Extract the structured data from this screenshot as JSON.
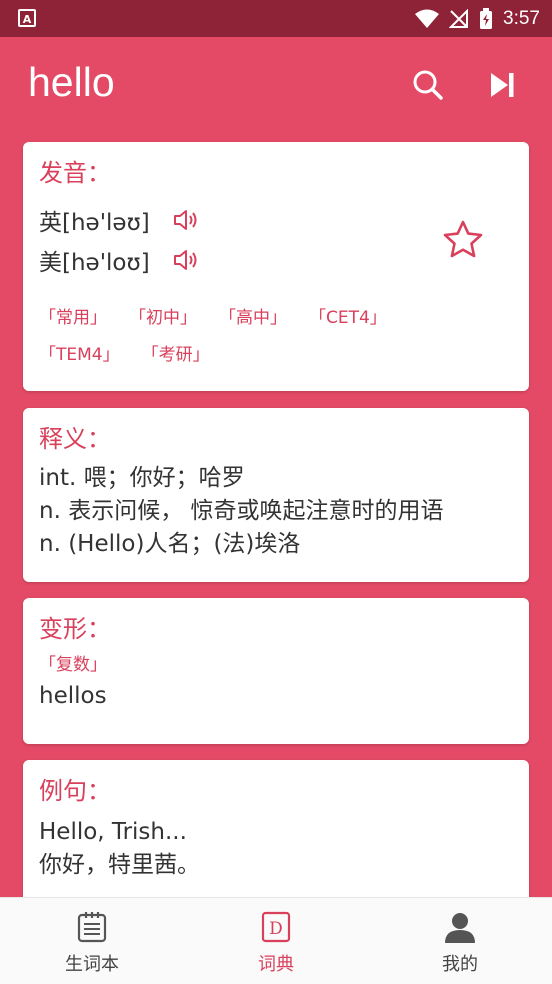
{
  "status_bar": {
    "left_icon_letter": "A",
    "time": "3:57"
  },
  "app_bar": {
    "title": "hello",
    "icons": [
      "search-icon",
      "skip-next-icon"
    ]
  },
  "pronunciation": {
    "heading": "发音：",
    "uk": "英[hə'ləʊ]",
    "us": "美[hə'loʊ]",
    "tags": [
      "「常用」",
      "「初中」",
      "「高中」",
      "「CET4」",
      "「TEM4」",
      "「考研」"
    ]
  },
  "definition": {
    "heading": "释义：",
    "lines": [
      "int. 喂；你好；哈罗",
      "n. 表示问候， 惊奇或唤起注意时的用语",
      "n. (Hello)人名；(法)埃洛"
    ]
  },
  "inflection": {
    "heading": "变形：",
    "label": "「复数」",
    "value": "hellos"
  },
  "example": {
    "heading": "例句：",
    "en": "Hello, Trish...",
    "zh": "你好，特里茜。"
  },
  "bottom_nav": {
    "items": [
      {
        "label": "生词本",
        "icon": "notebook-icon"
      },
      {
        "label": "词典",
        "icon": "dictionary-icon"
      },
      {
        "label": "我的",
        "icon": "person-icon"
      }
    ],
    "active": "词典"
  },
  "colors": {
    "accent": "#E44A65",
    "status_bar": "#8E2236",
    "heading": "#D9405C"
  }
}
